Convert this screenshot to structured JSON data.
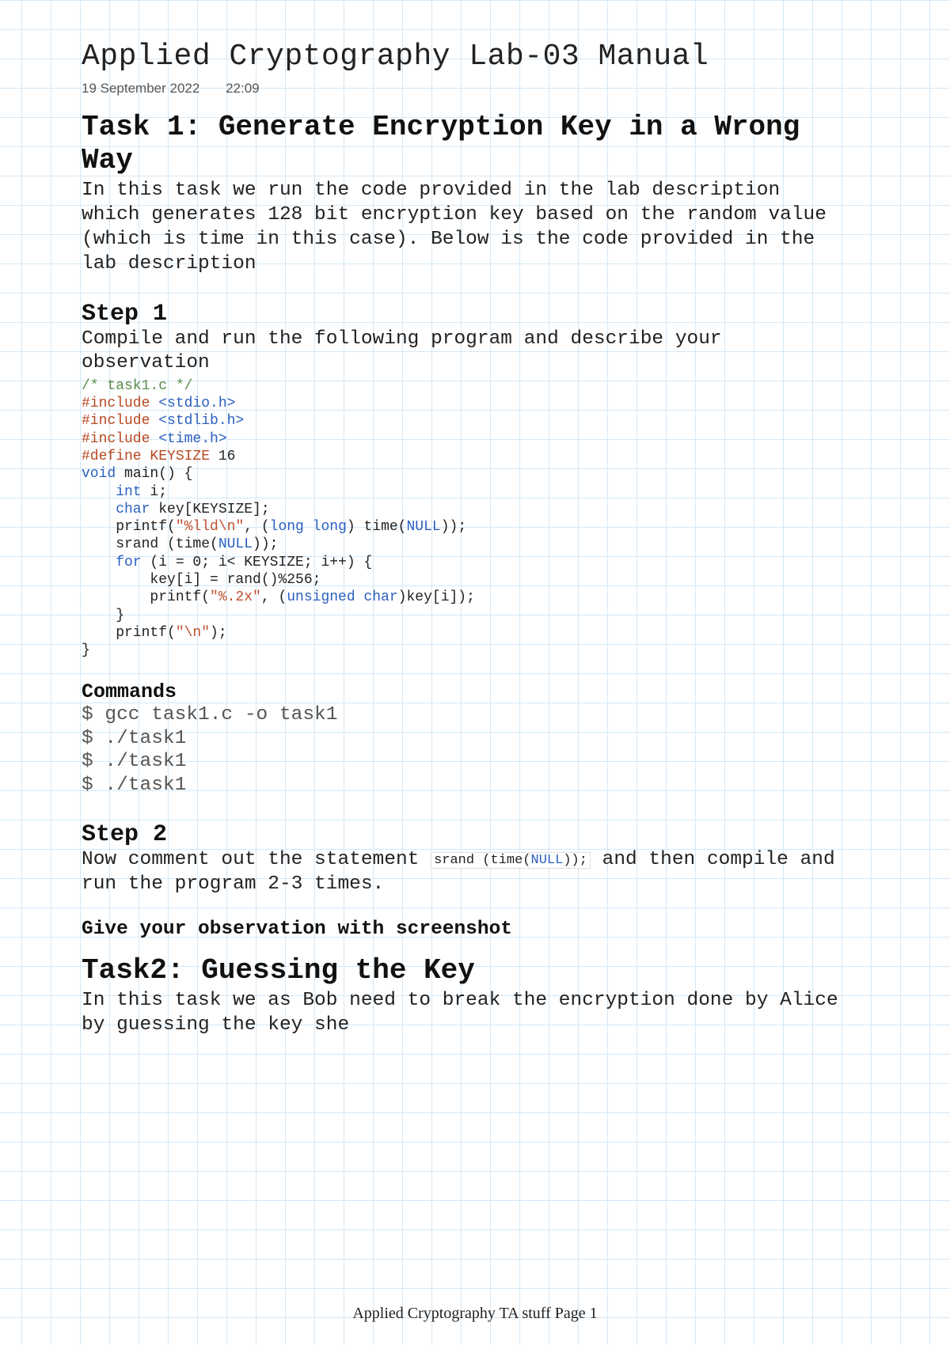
{
  "title": "Applied Cryptography Lab-03 Manual",
  "date": "19 September 2022",
  "time": "22:09",
  "task1": {
    "heading": "Task 1: Generate Encryption Key in a Wrong Way",
    "intro": "In this task we run the code provided in the lab description which generates 128 bit encryption key based on the random value (which is time in this case). Below is the code provided in the lab description",
    "step1_heading": "Step 1",
    "step1_body": "Compile and run the following program and describe your observation",
    "code": {
      "comment": "/* task1.c */",
      "inc1_pre": "#include ",
      "inc1_hdr": "<stdio.h>",
      "inc2_pre": "#include ",
      "inc2_hdr": "<stdlib.h>",
      "inc3_pre": "#include ",
      "inc3_hdr": "<time.h>",
      "def_pre": "#define KEYSIZE ",
      "def_val": "16",
      "main_kw": "void",
      "main_rest": " main() {",
      "int_kw": "    int",
      "int_rest": " i;",
      "char_kw": "    char",
      "char_rest": " key[KEYSIZE];",
      "p1a": "    printf(",
      "p1s": "\"%lld\\n\"",
      "p1b": ", (",
      "p1kw": "long long",
      "p1c": ") time(",
      "p1n": "NULL",
      "p1d": "));",
      "srand_a": "    srand (time(",
      "srand_n": "NULL",
      "srand_b": "));",
      "for_kw": "    for",
      "for_rest": " (i = 0; i< KEYSIZE; i++) {",
      "key_line": "        key[i] = rand()%256;",
      "p2a": "        printf(",
      "p2s": "\"%.2x\"",
      "p2b": ", (",
      "p2kw": "unsigned char",
      "p2c": ")key[i]);",
      "brace1": "    }",
      "p3a": "    printf(",
      "p3s": "\"\\n\"",
      "p3b": ");",
      "brace2": "}"
    },
    "commands_heading": "Commands",
    "commands": "$ gcc task1.c -o task1\n$ ./task1\n$ ./task1\n$ ./task1",
    "step2_heading": "Step 2",
    "step2_a": "Now comment out the statement ",
    "step2_code_a": "srand (time(",
    "step2_code_null": "NULL",
    "step2_code_b": "));",
    "step2_b": " and then compile and run the program 2-3 times.",
    "observation": "Give your observation with screenshot"
  },
  "task2": {
    "heading": "Task2: Guessing the Key",
    "body": "In this task we as Bob need to break the encryption done by Alice by guessing the key she"
  },
  "footer": "Applied Cryptography TA stuff Page 1"
}
